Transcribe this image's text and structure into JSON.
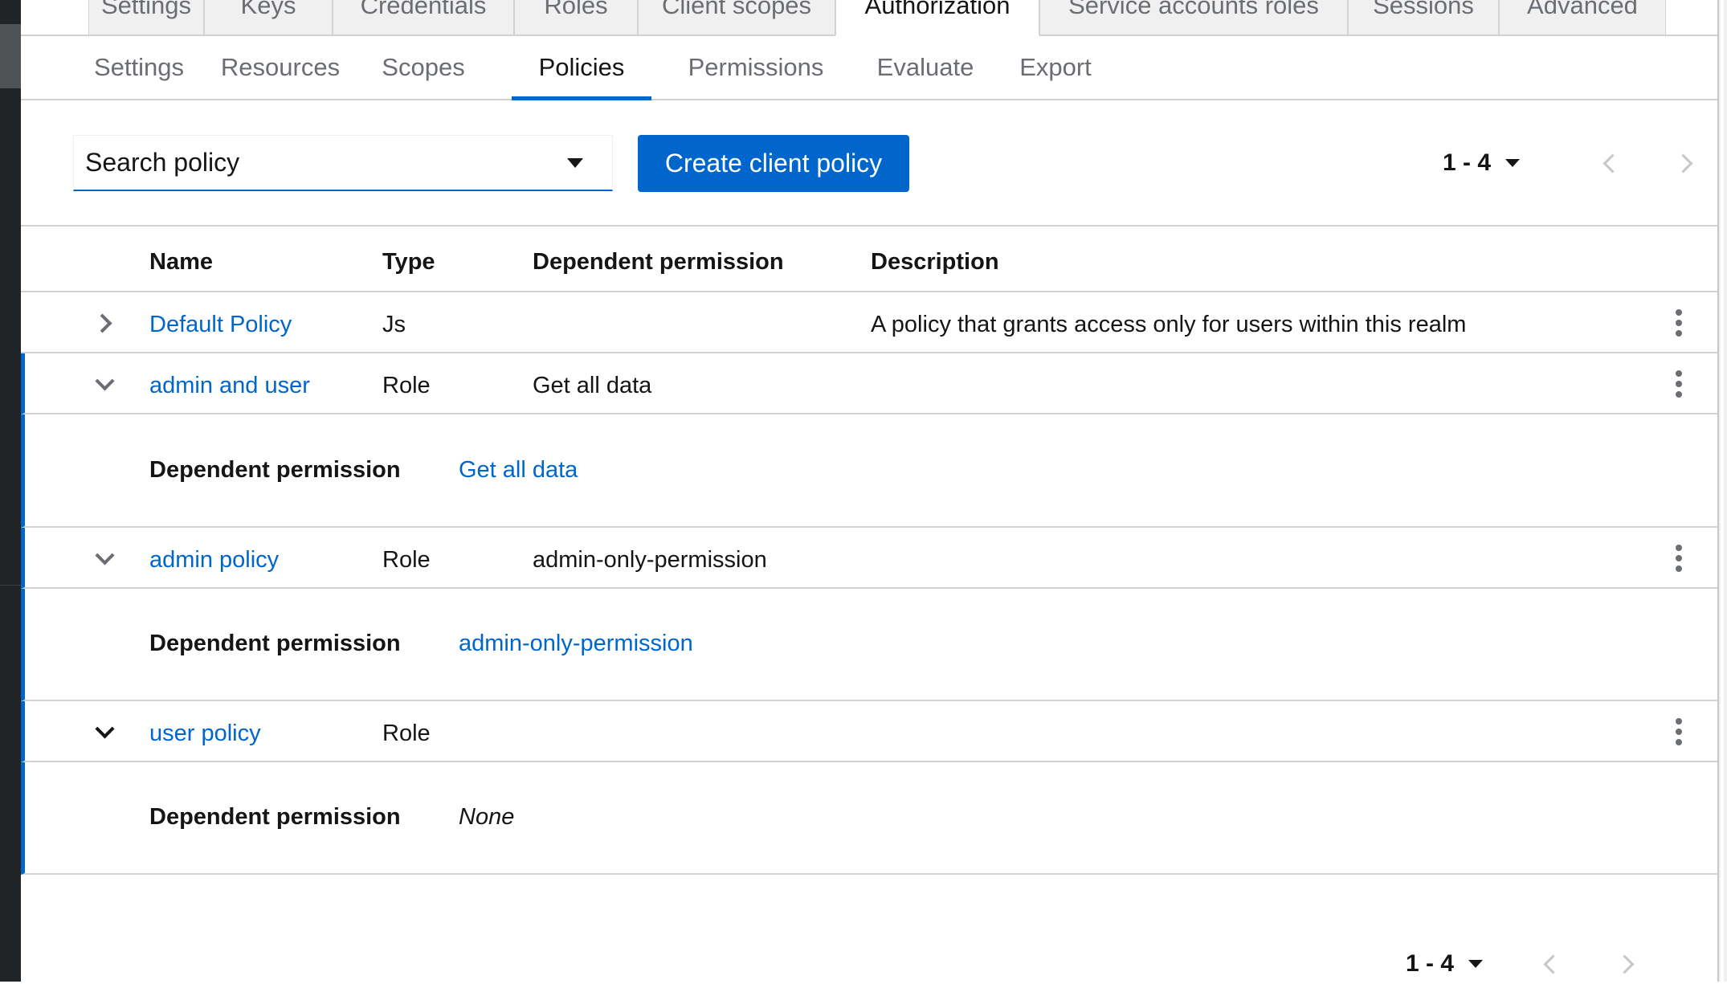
{
  "top_tabs": [
    {
      "label": "Settings",
      "active": false
    },
    {
      "label": "Keys",
      "active": false
    },
    {
      "label": "Credentials",
      "active": false
    },
    {
      "label": "Roles",
      "active": false
    },
    {
      "label": "Client scopes",
      "active": false
    },
    {
      "label": "Authorization",
      "active": true
    },
    {
      "label": "Service accounts roles",
      "active": false
    },
    {
      "label": "Sessions",
      "active": false
    },
    {
      "label": "Advanced",
      "active": false
    }
  ],
  "sub_tabs": [
    {
      "label": "Settings",
      "active": false
    },
    {
      "label": "Resources",
      "active": false
    },
    {
      "label": "Scopes",
      "active": false
    },
    {
      "label": "Policies",
      "active": true
    },
    {
      "label": "Permissions",
      "active": false
    },
    {
      "label": "Evaluate",
      "active": false
    },
    {
      "label": "Export",
      "active": false
    }
  ],
  "toolbar": {
    "search_label": "Search policy",
    "create_label": "Create client policy",
    "pagination": "1 - 4"
  },
  "table": {
    "headers": {
      "name": "Name",
      "type": "Type",
      "dependent": "Dependent permission",
      "description": "Description"
    },
    "rows": [
      {
        "name": "Default Policy",
        "type": "Js",
        "dependent": "",
        "description": "A policy that grants access only for users within this realm",
        "expanded": false
      },
      {
        "name": "admin and user",
        "type": "Role",
        "dependent": "Get all data",
        "description": "",
        "expanded": true,
        "detail_label": "Dependent permission",
        "detail_value": "Get all data"
      },
      {
        "name": "admin policy",
        "type": "Role",
        "dependent": "admin-only-permission",
        "description": "",
        "expanded": true,
        "detail_label": "Dependent permission",
        "detail_value": "admin-only-permission"
      },
      {
        "name": "user policy",
        "type": "Role",
        "dependent": "",
        "description": "",
        "expanded": true,
        "detail_label": "Dependent permission",
        "detail_value": "None"
      }
    ]
  },
  "bottom_pagination": "1 - 4",
  "colors": {
    "primary": "#0066cc",
    "text": "#151515",
    "muted": "#6a6e73",
    "border": "#d2d2d2"
  }
}
